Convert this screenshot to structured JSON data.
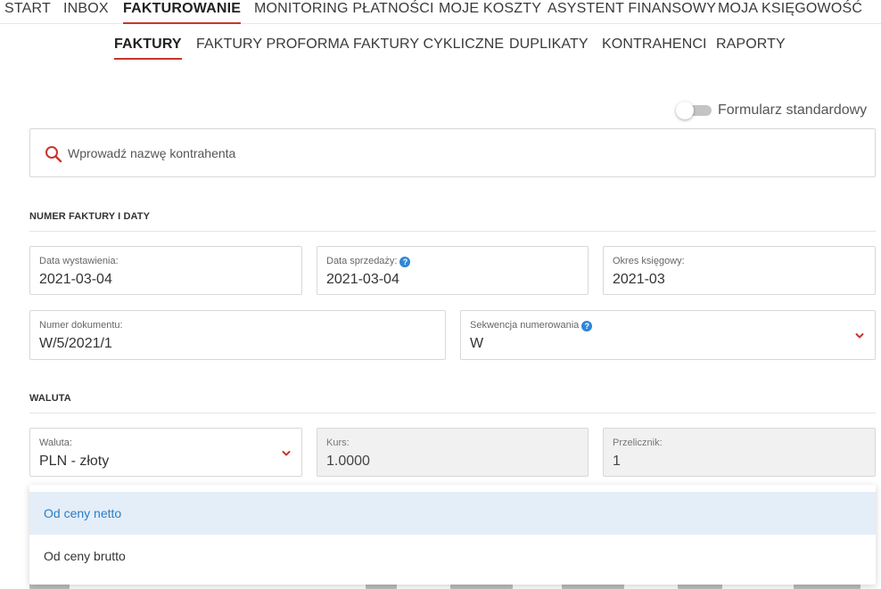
{
  "topnav": {
    "items": [
      {
        "label": "START",
        "active": false
      },
      {
        "label": "INBOX",
        "active": false
      },
      {
        "label": "FAKTUROWANIE",
        "active": true
      },
      {
        "label": "MONITORING PŁATNOŚCI",
        "active": false
      },
      {
        "label": "MOJE KOSZTY",
        "active": false
      },
      {
        "label": "ASYSTENT FINANSOWY",
        "active": false
      },
      {
        "label": "MOJA KSIĘGOWOŚĆ",
        "active": false
      }
    ]
  },
  "subnav": {
    "items": [
      {
        "label": "FAKTURY",
        "active": true
      },
      {
        "label": "FAKTURY PROFORMA",
        "active": false
      },
      {
        "label": "FAKTURY CYKLICZNE",
        "active": false
      },
      {
        "label": "DUPLIKATY",
        "active": false
      },
      {
        "label": "KONTRAHENCI",
        "active": false
      },
      {
        "label": "RAPORTY",
        "active": false
      }
    ]
  },
  "form_toggle": {
    "label": "Formularz standardowy",
    "enabled": false
  },
  "search": {
    "placeholder": "Wprowadź nazwę kontrahenta",
    "value": ""
  },
  "sections": {
    "invoice_dates": {
      "title": "NUMER FAKTURY I DATY",
      "issue_date": {
        "label": "Data wystawienia:",
        "value": "2021-03-04"
      },
      "sale_date": {
        "label": "Data sprzedaży:",
        "value": "2021-03-04"
      },
      "accounting_period": {
        "label": "Okres księgowy:",
        "value": "2021-03"
      },
      "document_number": {
        "label": "Numer dokumentu:",
        "value": "W/5/2021/1"
      },
      "numbering_sequence": {
        "label": "Sekwencja numerowania",
        "value": "W"
      }
    },
    "currency": {
      "title": "WALUTA",
      "currency": {
        "label": "Waluta:",
        "value": "PLN - złoty"
      },
      "rate": {
        "label": "Kurs:",
        "value": "1.0000"
      },
      "converter": {
        "label": "Przelicznik:",
        "value": "1"
      }
    }
  },
  "price_dropdown": {
    "options": [
      {
        "label": "Od ceny netto",
        "selected": true
      },
      {
        "label": "Od ceny brutto",
        "selected": false
      }
    ]
  },
  "icons": {
    "search": "search-icon",
    "help": "help-icon",
    "chevron": "chevron-down-icon"
  },
  "colors": {
    "accent": "#c8352d",
    "help": "#2f86d6",
    "selected_bg": "#e3eef8",
    "selected_text": "#2c7cc4",
    "readonly_bg": "#f1f1f1"
  }
}
